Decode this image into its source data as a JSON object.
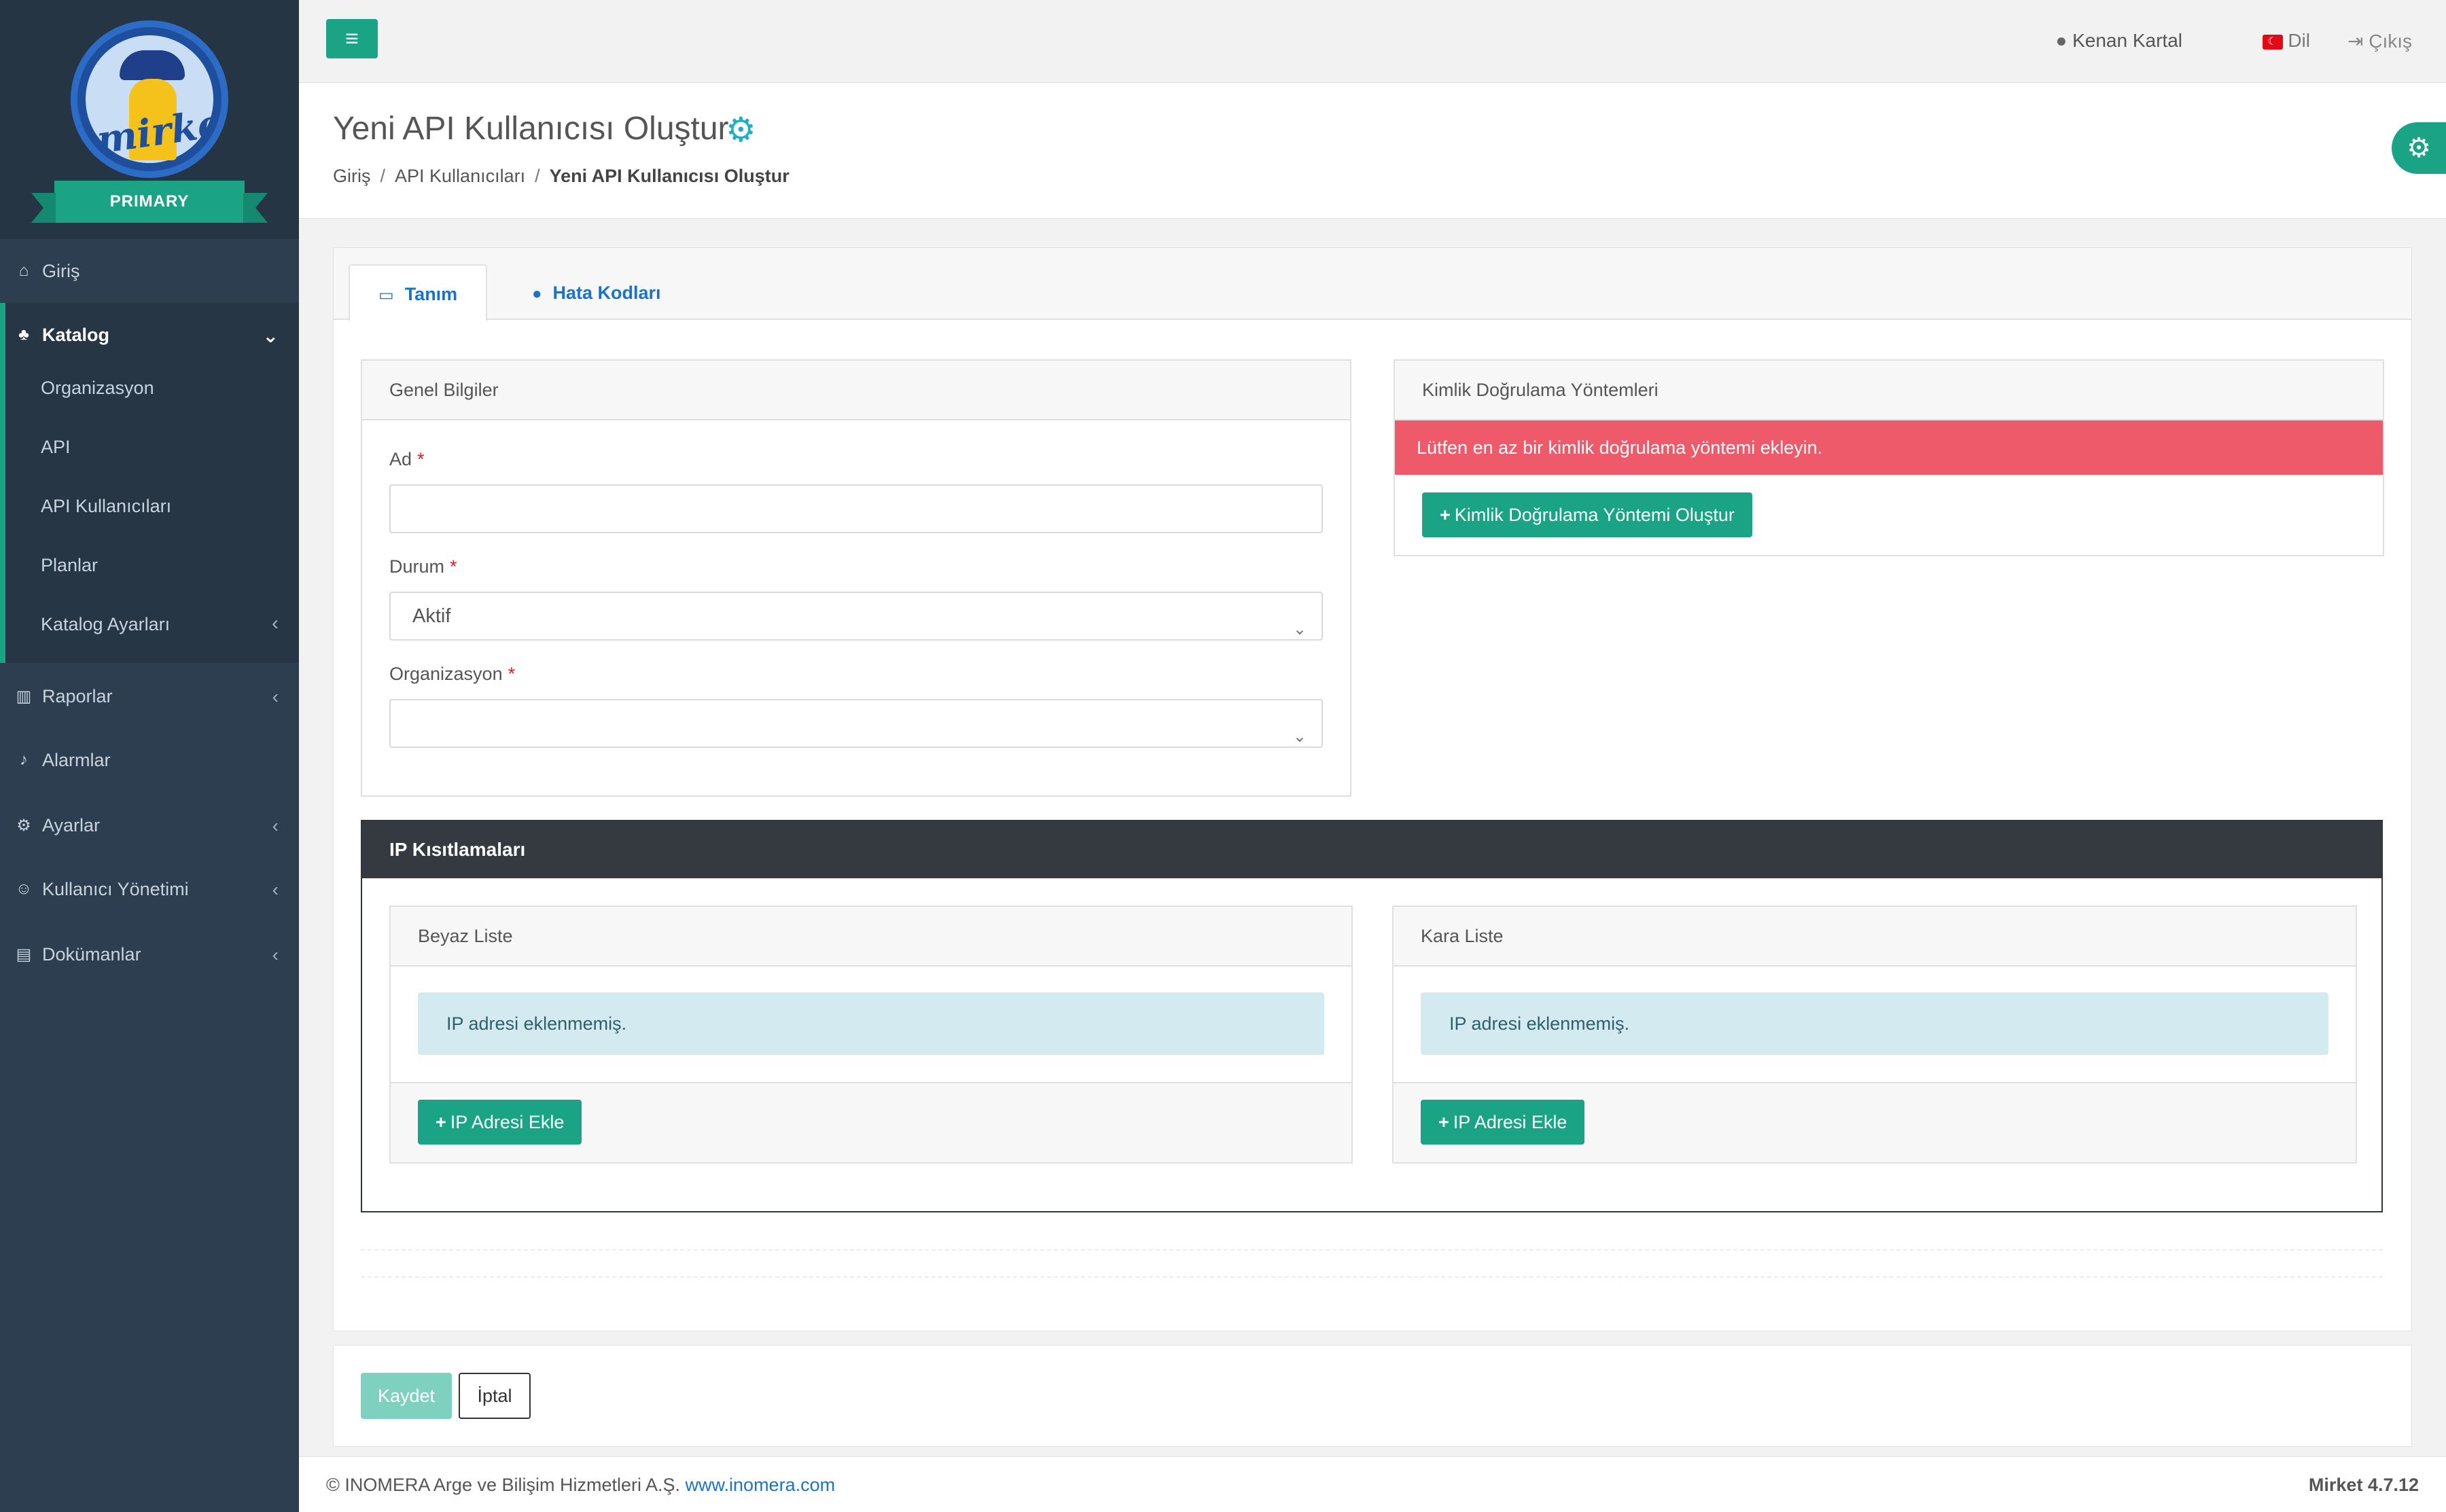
{
  "logo": {
    "text": "mirket",
    "ribbon": "PRIMARY"
  },
  "sidebar": {
    "items": [
      {
        "label": "Giriş",
        "icon": "home-icon"
      },
      {
        "label": "Katalog",
        "icon": "sitemap-icon"
      },
      {
        "label": "Raporlar",
        "icon": "chart-icon"
      },
      {
        "label": "Alarmlar",
        "icon": "bell-icon"
      },
      {
        "label": "Ayarlar",
        "icon": "gears-icon"
      },
      {
        "label": "Kullanıcı Yönetimi",
        "icon": "users-icon"
      },
      {
        "label": "Dokümanlar",
        "icon": "document-icon"
      }
    ],
    "catalog_sub": [
      "Organizasyon",
      "API",
      "API Kullanıcıları",
      "Planlar",
      "Katalog Ayarları"
    ]
  },
  "topbar": {
    "user": "Kenan Kartal",
    "language": "Dil",
    "logout": "Çıkış"
  },
  "header": {
    "title": "Yeni API Kullanıcısı Oluştur",
    "breadcrumb": [
      "Giriş",
      "API Kullanıcıları",
      "Yeni API Kullanıcısı Oluştur"
    ]
  },
  "tabs": [
    {
      "label": "Tanım",
      "active": true
    },
    {
      "label": "Hata Kodları",
      "active": false
    }
  ],
  "general": {
    "title": "Genel Bilgiler",
    "name_label": "Ad",
    "name_value": "",
    "status_label": "Durum",
    "status_value": "Aktif",
    "org_label": "Organizasyon",
    "org_value": "",
    "required_mark": "*"
  },
  "auth": {
    "title": "Kimlik Doğrulama Yöntemleri",
    "alert": "Lütfen en az bir kimlik doğrulama yöntemi ekleyin.",
    "create_button": "Kimlik Doğrulama Yöntemi Oluştur"
  },
  "ip": {
    "title": "IP Kısıtlamaları",
    "whitelist_title": "Beyaz Liste",
    "blacklist_title": "Kara Liste",
    "empty_text": "IP adresi eklenmemiş.",
    "add_button": "IP Adresi Ekle"
  },
  "actions": {
    "save": "Kaydet",
    "cancel": "İptal"
  },
  "footer": {
    "copyright": "© INOMERA Arge ve Bilişim Hizmetleri A.Ş.",
    "link": "www.inomera.com",
    "version": "Mirket 4.7.12"
  },
  "colors": {
    "sidebar": "#2c3e50",
    "accent": "#1aa385",
    "danger": "#ee5a69",
    "info": "#d3eaf0",
    "link": "#1a73c9"
  }
}
